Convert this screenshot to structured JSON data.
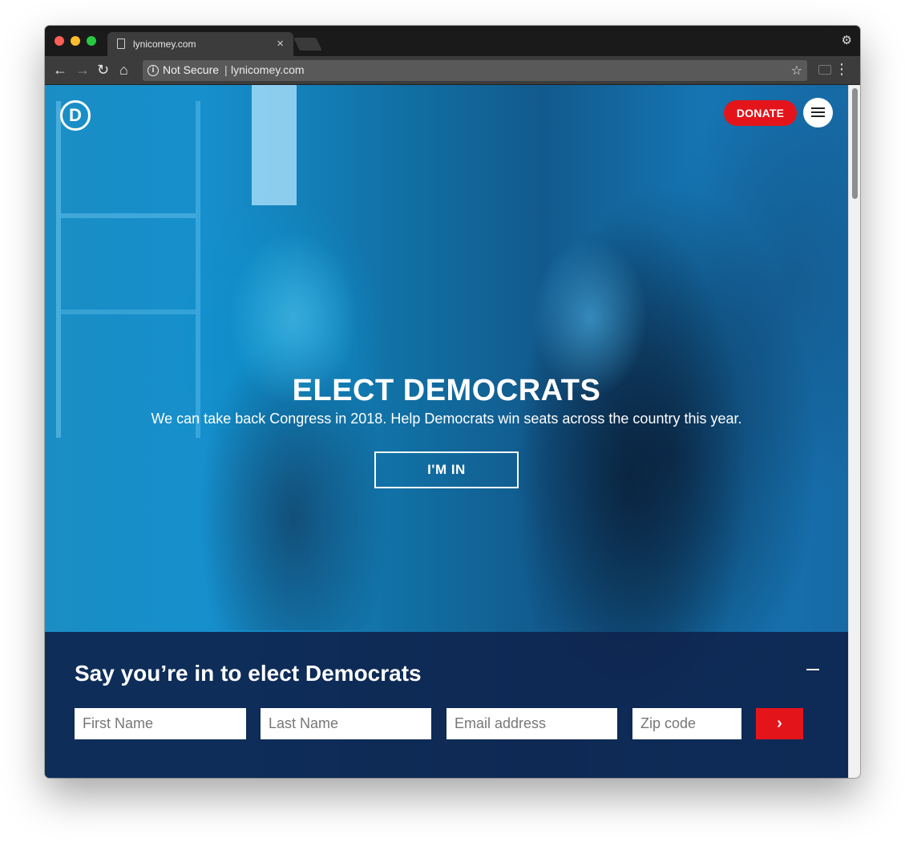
{
  "browser": {
    "tab_title": "lynicomey.com",
    "tab_close": "×",
    "security_label": "Not Secure",
    "separator": "|",
    "url": "lynicomey.com"
  },
  "header": {
    "logo_letter": "D",
    "donate_label": "DONATE"
  },
  "hero": {
    "title": "ELECT DEMOCRATS",
    "subtitle": "We can take back Congress in 2018. Help Democrats win seats across the country this year.",
    "cta_label": "I'M IN"
  },
  "signup": {
    "title": "Say you’re in to elect Democrats",
    "fields": {
      "first_name_placeholder": "First Name",
      "last_name_placeholder": "Last Name",
      "email_placeholder": "Email address",
      "zip_placeholder": "Zip code"
    },
    "submit_icon": "›"
  },
  "colors": {
    "accent_red": "#e4141b",
    "panel_navy": "#0e254f",
    "hero_blue": "#0e80b7"
  },
  "icons": [
    "page-icon",
    "close-icon",
    "incognito-icon",
    "back-icon",
    "forward-icon",
    "reload-icon",
    "home-icon",
    "info-icon",
    "star-icon",
    "cast-icon",
    "menu-dots-icon",
    "hamburger-icon",
    "chevron-right-icon",
    "minus-icon"
  ]
}
